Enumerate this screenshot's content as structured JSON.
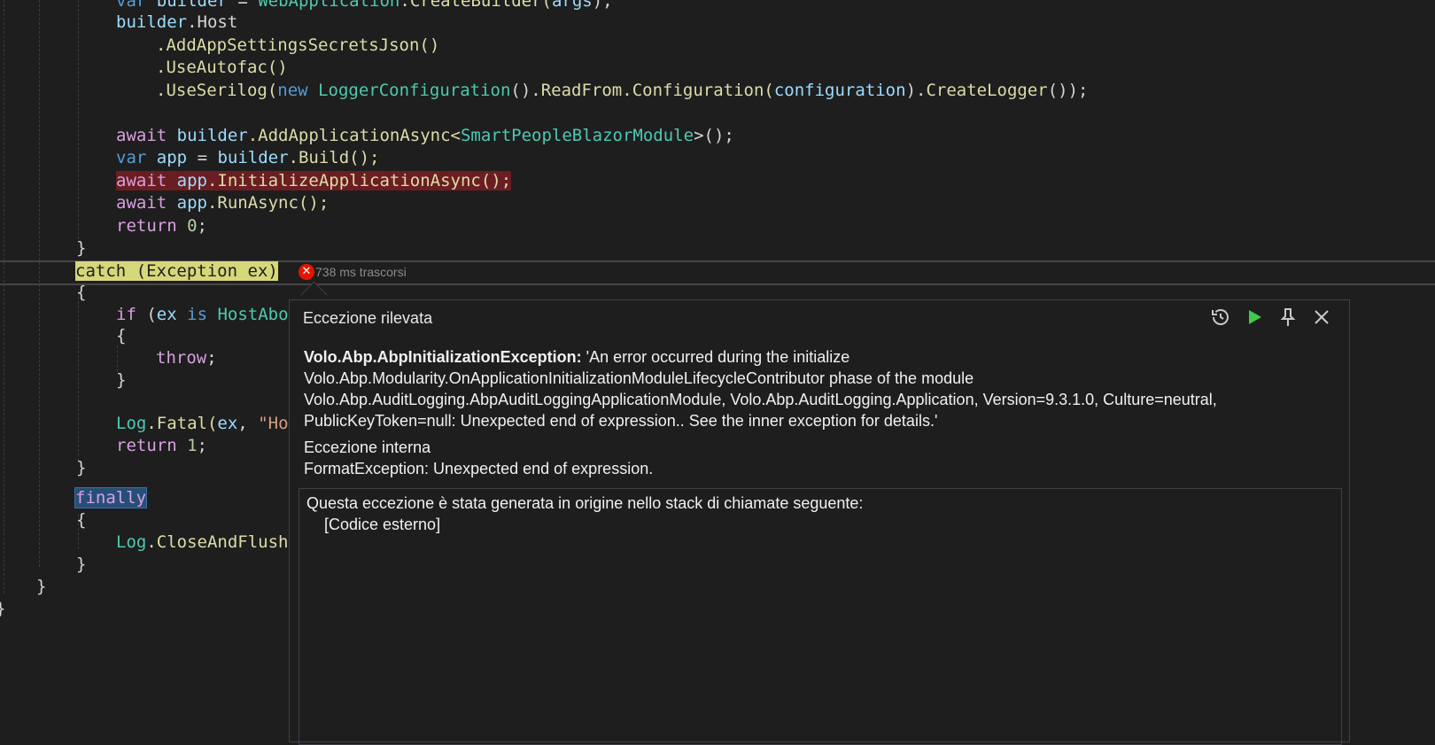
{
  "editor": {
    "lines": {
      "l0_a": "var",
      "l0_b": "builder",
      "l0_c": "=",
      "l0_d": "WebApplication",
      "l0_e": ".CreateBuilder(",
      "l0_f": "args",
      "l0_g": ");",
      "l1_a": "builder",
      "l1_b": ".Host",
      "l2": ".AddAppSettingsSecretsJson()",
      "l3": ".UseAutofac()",
      "l4_a": ".UseSerilog(",
      "l4_b": "new",
      "l4_c": "LoggerConfiguration",
      "l4_d": "().",
      "l4_e": "ReadFrom",
      "l4_f": ".Configuration(",
      "l4_g": "configuration",
      "l4_h": ").",
      "l4_i": "CreateLogger",
      "l4_j": "());",
      "l6_a": "await",
      "l6_b": "builder",
      "l6_c": ".AddApplicationAsync<",
      "l6_d": "SmartPeopleBlazorModule",
      "l6_e": ">();",
      "l7_a": "var",
      "l7_b": "app",
      "l7_c": "=",
      "l7_d": "builder",
      "l7_e": ".Build();",
      "l8_a": "await",
      "l8_b": "app",
      "l8_c": ".InitializeApplicationAsync();",
      "l9_a": "await",
      "l9_b": "app",
      "l9_c": ".RunAsync();",
      "l10_a": "return",
      "l10_b": "0",
      "l10_c": ";",
      "l11": "}",
      "l12_a": "catch",
      "l12_b": "(",
      "l12_c": "Exception",
      "l12_d": "ex",
      "l12_e": ")",
      "l13": "{",
      "l14_a": "if",
      "l14_b": "(",
      "l14_c": "ex",
      "l14_d": "is",
      "l14_e": "HostAbo",
      "l15": "{",
      "l16_a": "throw",
      "l16_b": ";",
      "l17": "}",
      "l19_a": "Log",
      "l19_b": ".Fatal(",
      "l19_c": "ex",
      "l19_d": ",",
      "l19_e": "\"Ho",
      "l20_a": "return",
      "l20_b": "1",
      "l20_c": ";",
      "l21": "}",
      "l22": "finally",
      "l23": "{",
      "l24_a": "Log",
      "l24_b": ".CloseAndFlush",
      "l25": "}",
      "l26": "}",
      "l27": "}"
    }
  },
  "perf_tip": {
    "elapsed": "738 ms trascorsi",
    "icon": "error-x-icon"
  },
  "exception_popup": {
    "title": "Eccezione rilevata",
    "exception_type": "Volo.Abp.AbpInitializationException:",
    "message_1": " 'An error occurred during the initialize",
    "message_2": "Volo.Abp.Modularity.OnApplicationInitializationModuleLifecycleContributor phase of the module",
    "message_3": "Volo.Abp.AuditLogging.AbpAuditLoggingApplicationModule, Volo.Abp.AuditLogging.Application, Version=9.3.1.0, Culture=neutral,",
    "message_4": "PublicKeyToken=null: Unexpected end of expression.. See the inner exception for details.'",
    "inner_heading": "Eccezione interna",
    "inner_value": "FormatException: Unexpected end of expression.",
    "stack_heading": "Questa eccezione è stata generata in origine nello stack di chiamate seguente:",
    "stack_item": "[Codice esterno]",
    "actions": [
      "history-icon",
      "continue-icon",
      "pin-icon",
      "close-icon"
    ]
  },
  "colors": {
    "editor_bg": "#1e1e1e",
    "keyword_blue": "#569cd6",
    "keyword_purple": "#d8a0df",
    "type_teal": "#4ec9b0",
    "method_yellow": "#dcdcaa",
    "variable_lightblue": "#9cdcfe",
    "number_green": "#b5cea8",
    "error_red": "#e51400",
    "highlight_red": "#6b1e22",
    "highlight_yellow": "#d5d77a"
  }
}
